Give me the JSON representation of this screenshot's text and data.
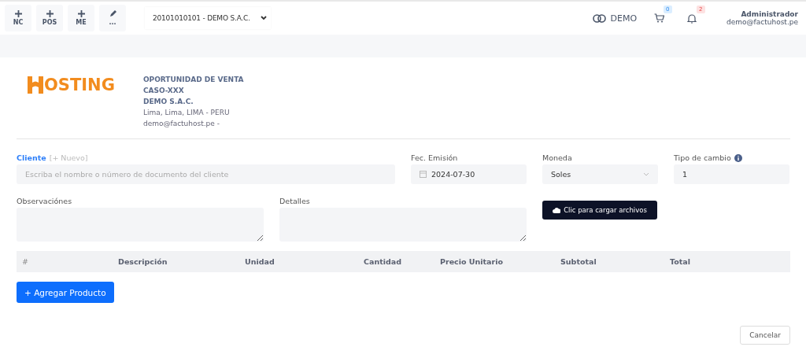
{
  "toolbar": {
    "shortcuts": [
      {
        "kind": "plus",
        "label": "NC"
      },
      {
        "kind": "plus",
        "label": "POS"
      },
      {
        "kind": "plus",
        "label": "ME"
      },
      {
        "kind": "pencil",
        "label": "..."
      }
    ],
    "company_select": "20101010101 - DEMO S.A.C.",
    "mode": "DEMO",
    "cart_badge": "0",
    "notification_badge": "2",
    "user": {
      "name": "Administrador",
      "email": "demo@factuhost.pe"
    }
  },
  "company": {
    "logo": "OSTING",
    "lines": [
      {
        "text": "OPORTUNIDAD DE VENTA",
        "bold": true
      },
      {
        "text": "CASO-XXX",
        "bold": true
      },
      {
        "text": "DEMO S.A.C.",
        "bold": true
      },
      {
        "text": "Lima, Lima, LIMA - PERU",
        "bold": false
      },
      {
        "text": "demo@factuhost.pe -",
        "bold": false
      }
    ]
  },
  "form": {
    "cliente": {
      "label": "Cliente",
      "link": "[+ Nuevo]",
      "placeholder": "Escriba el nombre o número de documento del cliente"
    },
    "fecha": {
      "label": "Fec. Emisión",
      "value": "2024-07-30"
    },
    "moneda": {
      "label": "Moneda",
      "value": "Soles"
    },
    "tipo_cambio": {
      "label": "Tipo de cambio",
      "value": "1"
    },
    "observaciones": {
      "label": "Observaciónes"
    },
    "detalles": {
      "label": "Detalles"
    },
    "upload_button": "Clic para cargar archivos"
  },
  "table": {
    "columns": [
      "#",
      "Descripción",
      "Unidad",
      "Cantidad",
      "Precio Unitario",
      "Subtotal",
      "Total"
    ]
  },
  "add_button": "+ Agregar Producto",
  "cancel_button": "Cancelar"
}
